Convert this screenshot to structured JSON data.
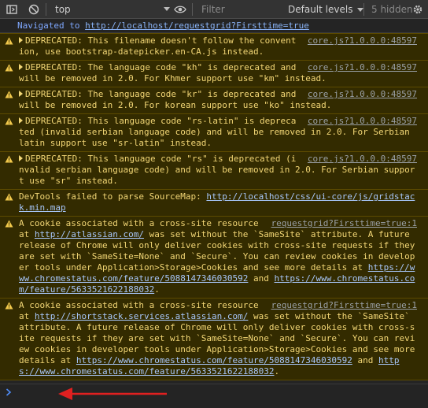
{
  "toolbar": {
    "context": "top",
    "filter_placeholder": "Filter",
    "levels": "Default levels",
    "hidden": "5 hidden",
    "icons": [
      "sidebar-toggle-icon",
      "block-icon",
      "eye-icon",
      "settings-gear-icon"
    ]
  },
  "nav": {
    "prefix": "Navigated to ",
    "url": "http://localhost/requestgrid?Firsttime=true"
  },
  "warnings": [
    {
      "source": "core.js?1.0.0.0:48597",
      "text": "DEPRECATED: This filename doesn't follow the convention, use bootstrap-datepicker.en-CA.js instead."
    },
    {
      "source": "core.js?1.0.0.0:48597",
      "text": "DEPRECATED: The language code \"kh\" is deprecated and will be removed in 2.0. For Khmer support use \"km\" instead."
    },
    {
      "source": "core.js?1.0.0.0:48597",
      "text": "DEPRECATED: The language code \"kr\" is deprecated and will be removed in 2.0. For korean support use \"ko\" instead."
    },
    {
      "source": "core.js?1.0.0.0:48597",
      "text": "DEPRECATED: This language code \"rs-latin\" is deprecated (invalid serbian language code) and will be removed in 2.0. For Serbian latin support use \"sr-latin\" instead."
    },
    {
      "source": "core.js?1.0.0.0:48597",
      "text": "DEPRECATED: This language code \"rs\" is deprecated (invalid serbian language code) and will be removed in 2.0. For Serbian support use \"sr\" instead."
    }
  ],
  "sourcemap": {
    "text": "DevTools failed to parse SourceMap: ",
    "url": "http://localhost/css/ui-core/js/gridstack.min.map"
  },
  "cookie1": {
    "source": "requestgrid?Firsttime=true:1",
    "t1": "A cookie associated with a cross-site resource at ",
    "domain": "http://atlassian.com/",
    "t2": " was set without the `SameSite` attribute. A future release of Chrome will only deliver cookies with cross-site requests if they are set with `SameSite=None` and `Secure`. You can review cookies in developer tools under Application>Storage>Cookies and see more details at ",
    "link1": "https://www.chromestatus.com/feature/5088147346030592",
    "and": " and ",
    "link2": "https://www.chromestatus.com/feature/5633521622188032",
    "end": "."
  },
  "cookie2": {
    "source": "requestgrid?Firsttime=true:1",
    "t1": "A cookie associated with a cross-site resource at ",
    "domain": "http://shortstack.services.atlassian.com/",
    "t2": " was set without the `SameSite` attribute. A future release of Chrome will only deliver cookies with cross-site requests if they are set with `SameSite=None` and `Secure`. You can review cookies in developer tools under Application>Storage>Cookies and see more details at ",
    "link1": "https://www.chromestatus.com/feature/5088147346030592",
    "and": " and ",
    "link2": "https://www.chromestatus.com/feature/5633521622188032",
    "end": "."
  },
  "colors": {
    "warning_bg": "#332b00",
    "warning_text": "#f2d675",
    "link": "#a8c7fa",
    "annotation_arrow": "#e02020"
  }
}
